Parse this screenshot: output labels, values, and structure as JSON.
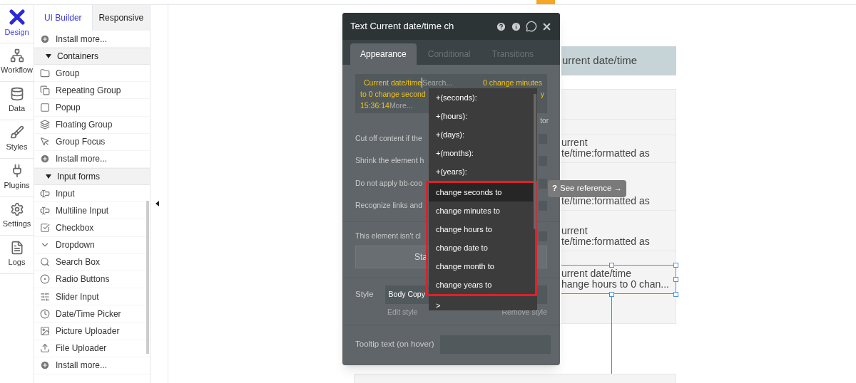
{
  "rail": [
    {
      "label": "Design",
      "selected": true
    },
    {
      "label": "Workflow",
      "selected": false
    },
    {
      "label": "Data",
      "selected": false
    },
    {
      "label": "Styles",
      "selected": false
    },
    {
      "label": "Plugins",
      "selected": false
    },
    {
      "label": "Settings",
      "selected": false
    },
    {
      "label": "Logs",
      "selected": false
    }
  ],
  "sidebar": {
    "tabs": [
      {
        "label": "UI Builder",
        "selected": true
      },
      {
        "label": "Responsive",
        "selected": false
      }
    ],
    "items": [
      {
        "kind": "install",
        "label": "Install more..."
      },
      {
        "kind": "section",
        "label": "Containers",
        "expanded": true
      },
      {
        "kind": "element",
        "label": "Group"
      },
      {
        "kind": "element",
        "label": "Repeating Group"
      },
      {
        "kind": "element",
        "label": "Popup"
      },
      {
        "kind": "element",
        "label": "Floating Group"
      },
      {
        "kind": "element",
        "label": "Group Focus"
      },
      {
        "kind": "install",
        "label": "Install more..."
      },
      {
        "kind": "section",
        "label": "Input forms",
        "expanded": true
      },
      {
        "kind": "element",
        "label": "Input"
      },
      {
        "kind": "element",
        "label": "Multiline Input"
      },
      {
        "kind": "element",
        "label": "Checkbox"
      },
      {
        "kind": "element",
        "label": "Dropdown"
      },
      {
        "kind": "element",
        "label": "Search Box"
      },
      {
        "kind": "element",
        "label": "Radio Buttons"
      },
      {
        "kind": "element",
        "label": "Slider Input"
      },
      {
        "kind": "element",
        "label": "Date/Time Picker"
      },
      {
        "kind": "element",
        "label": "Picture Uploader"
      },
      {
        "kind": "element",
        "label": "File Uploader"
      },
      {
        "kind": "install",
        "label": "Install more..."
      }
    ]
  },
  "canvas": {
    "header_text": "urrent date/time",
    "rows": [
      {
        "selected": false,
        "lines": [
          "urrent",
          "te/time:formatted as"
        ]
      },
      {
        "selected": false,
        "lines": [
          "te/time:formatted as"
        ]
      },
      {
        "selected": false,
        "lines": [
          "urrent",
          "te/time:formatted as"
        ]
      },
      {
        "selected": true,
        "lines": [
          "urrent date/time",
          "hange hours to 0 chan..."
        ]
      }
    ]
  },
  "property_panel": {
    "title": "Text Current date/time ch",
    "tabs": [
      {
        "label": "Appearance",
        "selected": true
      },
      {
        "label": "Conditional",
        "selected": false
      },
      {
        "label": "Transitions",
        "selected": false
      }
    ],
    "expression": {
      "lead": "Current date/time",
      "search_placeholder": "Search...",
      "after_search": "0 change minutes",
      "line_2": "to 0 change second",
      "line_2_end": "y",
      "line_3": "15:36:14",
      "more": "More..."
    },
    "editor_hint": "tor",
    "options": [
      {
        "label": "Cut off content if the",
        "checked": false
      },
      {
        "label": "Shrink the element h",
        "checked": false
      },
      {
        "label": "Do not apply bb-coo",
        "checked": false
      },
      {
        "label": "Recognize links and",
        "checked": false
      }
    ],
    "note": {
      "label": "This element isn't cl",
      "checked": false
    },
    "button": "Sta",
    "style": {
      "label": "Style",
      "value": "Body Copy",
      "edit_link": "Edit style",
      "remove_link": "Remove style"
    },
    "tooltip_field": {
      "label": "Tooltip text (on hover)"
    }
  },
  "dropdown": {
    "groups": [
      {
        "outlined": false,
        "items": [
          {
            "label": "+(seconds):",
            "selected": false
          },
          {
            "label": "+(hours):",
            "selected": false
          },
          {
            "label": "+(days):",
            "selected": false
          },
          {
            "label": "+(months):",
            "selected": false
          },
          {
            "label": "+(years):",
            "selected": false
          }
        ]
      },
      {
        "outlined": true,
        "items": [
          {
            "label": "change seconds to",
            "selected": true
          },
          {
            "label": "change minutes to",
            "selected": false
          },
          {
            "label": "change hours to",
            "selected": false
          },
          {
            "label": "change date to",
            "selected": false
          },
          {
            "label": "change month to",
            "selected": false
          },
          {
            "label": "change years to",
            "selected": false
          }
        ]
      },
      {
        "outlined": false,
        "items": [
          {
            "label": ">",
            "selected": false
          }
        ]
      }
    ]
  },
  "reference_tooltip": {
    "icon_text": "?",
    "label": "See reference →"
  }
}
